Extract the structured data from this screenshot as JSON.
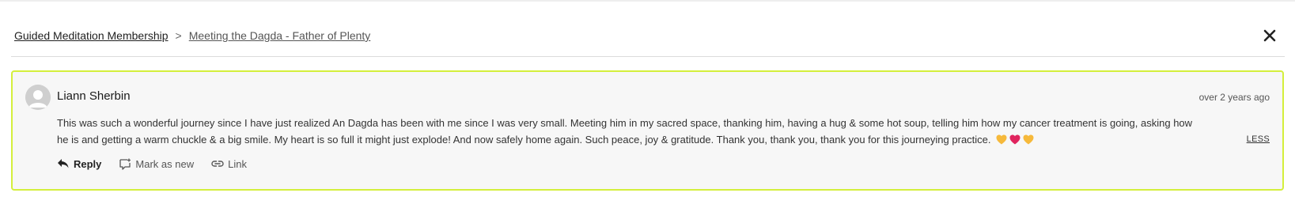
{
  "breadcrumb": {
    "root": "Guided Meditation Membership",
    "separator": ">",
    "current": "Meeting the Dagda - Father of Plenty"
  },
  "close": {
    "icon": "close-icon"
  },
  "comment": {
    "author": "Liann Sherbin",
    "timestamp": "over 2 years ago",
    "body": "This was such a wonderful journey since I have just realized An Dagda has been with me since I was very small.  Meeting him in my sacred space, thanking him, having a hug & some hot soup, telling him how my cancer treatment is going, asking how he is and getting a warm chuckle & a big smile.  My heart is so full it might just explode!  And now safely home again.  Such peace, joy & gratitude.  Thank you, thank you, thank you for this journeying practice.",
    "emojis": [
      "yellow-heart",
      "red-heart",
      "yellow-heart"
    ],
    "less_label": "LESS",
    "border_color": "#d4ef3c"
  },
  "actions": {
    "reply_label": "Reply",
    "mark_new_label": "Mark as new",
    "link_label": "Link"
  }
}
